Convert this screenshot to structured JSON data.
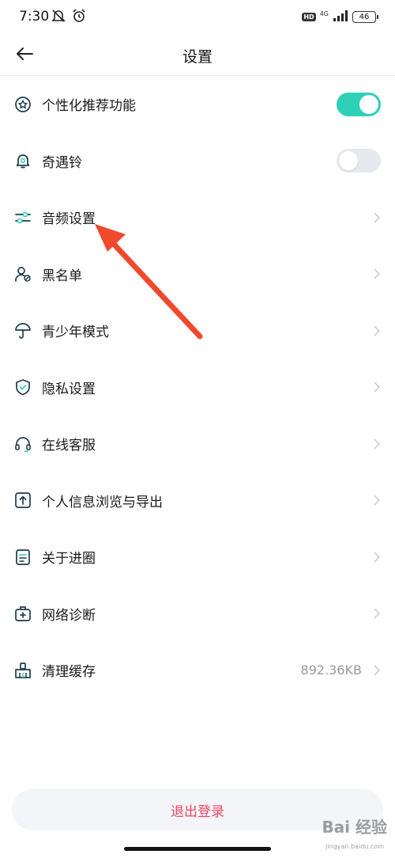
{
  "status_bar": {
    "time": "7:30",
    "hd": "HD",
    "network": "4G",
    "battery": "46"
  },
  "header": {
    "title": "设置"
  },
  "settings": [
    {
      "label": "个性化推荐功能",
      "icon": "star-badge-icon",
      "control": "toggle",
      "enabled": true
    },
    {
      "label": "奇遇铃",
      "icon": "bell-icon",
      "control": "toggle",
      "enabled": false
    },
    {
      "label": "音频设置",
      "icon": "sliders-icon",
      "control": "chevron"
    },
    {
      "label": "黑名单",
      "icon": "user-block-icon",
      "control": "chevron"
    },
    {
      "label": "青少年模式",
      "icon": "umbrella-icon",
      "control": "chevron"
    },
    {
      "label": "隐私设置",
      "icon": "shield-check-icon",
      "control": "chevron"
    },
    {
      "label": "在线客服",
      "icon": "headset-icon",
      "control": "chevron"
    },
    {
      "label": "个人信息浏览与导出",
      "icon": "export-icon",
      "control": "chevron"
    },
    {
      "label": "关于进圈",
      "icon": "document-icon",
      "control": "chevron"
    },
    {
      "label": "网络诊断",
      "icon": "first-aid-kit-icon",
      "control": "chevron"
    },
    {
      "label": "清理缓存",
      "icon": "broom-icon",
      "control": "chevron",
      "value": "892.36KB"
    }
  ],
  "logout": {
    "label": "退出登录"
  },
  "colors": {
    "accent": "#2ed1b8",
    "icon": "#1f3b4d",
    "danger": "#ef4466",
    "arrow": "#f0492c"
  },
  "watermark": {
    "text": "Bai 经验",
    "url": "jingyan.baidu.com"
  }
}
